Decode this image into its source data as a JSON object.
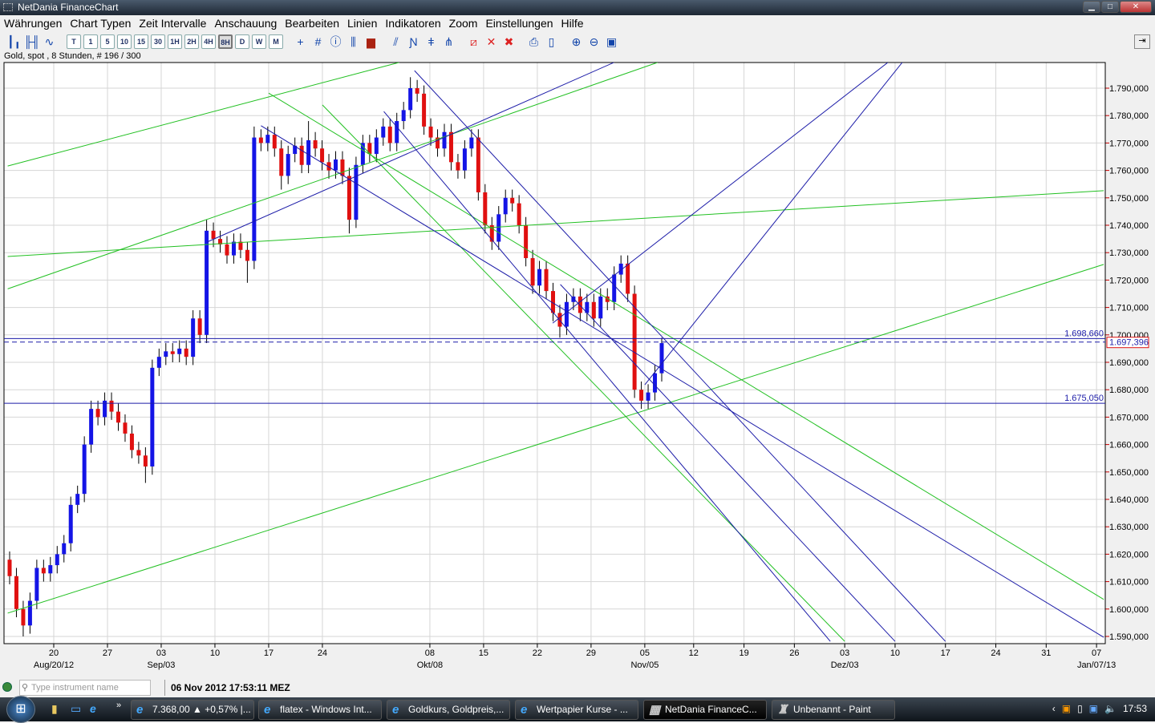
{
  "window": {
    "title": "NetDania FinanceChart",
    "buttons": [
      "minimize",
      "maximize",
      "close"
    ]
  },
  "menu": [
    "Währungen",
    "Chart Typen",
    "Zeit Intervalle",
    "Anschauung",
    "Bearbeiten",
    "Linien",
    "Indikatoren",
    "Zoom",
    "Einstellungen",
    "Hilfe"
  ],
  "toolbar": {
    "chart_type_icons": [
      "candlestick-icon",
      "bar-chart-icon",
      "line-chart-icon"
    ],
    "intervals": [
      "T",
      "1",
      "5",
      "10",
      "15",
      "30",
      "1H",
      "2H",
      "4H",
      "8H",
      "D",
      "W",
      "M"
    ],
    "selected_interval": "8H",
    "tool_icons": [
      "crosshair-icon",
      "grid-icon",
      "info-icon",
      "volume-icon",
      "histogram-icon",
      "trendline-icon",
      "channel-icon",
      "fibonacci-icon",
      "fan-icon",
      "delete-line-icon",
      "delete-icon",
      "delete-all-icon",
      "print-icon",
      "print-preview-icon",
      "zoom-in-icon",
      "zoom-out-icon",
      "zoom-reset-icon"
    ],
    "right_icon": "panel-toggle-icon"
  },
  "info_line": "Gold, spot , 8 Stunden, # 196 / 300",
  "colors": {
    "up": "#1414e6",
    "down": "#e01010",
    "grid": "#d6d6d6",
    "green_line": "#22c022",
    "blue_line": "#1c1ca8",
    "label_blue": "#1c1ca8",
    "last_price_border": "#e01010"
  },
  "chart_data": {
    "type": "candlestick",
    "instrument": "Gold, spot",
    "interval": "8 Stunden",
    "ylim": [
      1587,
      1799
    ],
    "yticks": [
      1590,
      1600,
      1610,
      1620,
      1630,
      1640,
      1650,
      1660,
      1670,
      1680,
      1690,
      1700,
      1710,
      1720,
      1730,
      1740,
      1750,
      1760,
      1770,
      1780,
      1790
    ],
    "ytick_labels": [
      "1.590,000",
      "1.600,000",
      "1.610,000",
      "1.620,000",
      "1.630,000",
      "1.640,000",
      "1.650,000",
      "1.660,000",
      "1.670,000",
      "1.680,000",
      "1.690,000",
      "1.700,000",
      "1.710,000",
      "1.720,000",
      "1.730,000",
      "1.740,000",
      "1.750,000",
      "1.760,000",
      "1.770,000",
      "1.780,000",
      "1.790,000"
    ],
    "xticks": [
      {
        "date": "2012-08-20",
        "label": "20",
        "sub": "Aug/20/12"
      },
      {
        "date": "2012-08-27",
        "label": "27"
      },
      {
        "date": "2012-09-03",
        "label": "03",
        "sub": "Sep/03"
      },
      {
        "date": "2012-09-10",
        "label": "10"
      },
      {
        "date": "2012-09-17",
        "label": "17"
      },
      {
        "date": "2012-09-24",
        "label": "24"
      },
      {
        "date": "2012-10-08",
        "label": "08",
        "sub": "Okt/08"
      },
      {
        "date": "2012-10-15",
        "label": "15"
      },
      {
        "date": "2012-10-22",
        "label": "22"
      },
      {
        "date": "2012-10-29",
        "label": "29"
      },
      {
        "date": "2012-11-05",
        "label": "05",
        "sub": "Nov/05"
      },
      {
        "date": "2012-11-12",
        "label": "12"
      },
      {
        "date": "2012-11-19",
        "label": "19"
      },
      {
        "date": "2012-11-26",
        "label": "26"
      },
      {
        "date": "2012-12-03",
        "label": "03",
        "sub": "Dez/03"
      },
      {
        "date": "2012-12-10",
        "label": "10"
      },
      {
        "date": "2012-12-17",
        "label": "17"
      },
      {
        "date": "2012-12-24",
        "label": "24"
      },
      {
        "date": "2012-12-31",
        "label": "31"
      },
      {
        "date": "2013-01-07",
        "label": "07",
        "sub": "Jan/07/13"
      }
    ],
    "candles_ohlc": [
      [
        1618,
        1621,
        1609,
        1612
      ],
      [
        1612,
        1615,
        1597,
        1600
      ],
      [
        1600,
        1603,
        1590,
        1594
      ],
      [
        1594,
        1606,
        1591,
        1603
      ],
      [
        1603,
        1618,
        1600,
        1615
      ],
      [
        1615,
        1618,
        1610,
        1613
      ],
      [
        1613,
        1619,
        1610,
        1616
      ],
      [
        1616,
        1623,
        1613,
        1620
      ],
      [
        1620,
        1627,
        1617,
        1624
      ],
      [
        1624,
        1641,
        1621,
        1638
      ],
      [
        1638,
        1645,
        1635,
        1642
      ],
      [
        1642,
        1663,
        1639,
        1660
      ],
      [
        1660,
        1676,
        1657,
        1673
      ],
      [
        1673,
        1676,
        1667,
        1670
      ],
      [
        1670,
        1679,
        1667,
        1676
      ],
      [
        1676,
        1679,
        1669,
        1672
      ],
      [
        1672,
        1675,
        1665,
        1668
      ],
      [
        1668,
        1671,
        1661,
        1664
      ],
      [
        1664,
        1667,
        1655,
        1658
      ],
      [
        1658,
        1661,
        1653,
        1656
      ],
      [
        1656,
        1659,
        1646,
        1652
      ],
      [
        1652,
        1691,
        1649,
        1688
      ],
      [
        1688,
        1695,
        1685,
        1692
      ],
      [
        1692,
        1697,
        1689,
        1694
      ],
      [
        1694,
        1697,
        1690,
        1693
      ],
      [
        1693,
        1698,
        1690,
        1695
      ],
      [
        1695,
        1698,
        1689,
        1692
      ],
      [
        1692,
        1709,
        1689,
        1706
      ],
      [
        1706,
        1709,
        1697,
        1700
      ],
      [
        1700,
        1742,
        1697,
        1738
      ],
      [
        1738,
        1741,
        1732,
        1735
      ],
      [
        1735,
        1738,
        1730,
        1733
      ],
      [
        1733,
        1736,
        1726,
        1729
      ],
      [
        1729,
        1737,
        1726,
        1734
      ],
      [
        1734,
        1737,
        1728,
        1731
      ],
      [
        1731,
        1734,
        1719,
        1727
      ],
      [
        1727,
        1776,
        1724,
        1772
      ],
      [
        1772,
        1775,
        1767,
        1770
      ],
      [
        1770,
        1776,
        1767,
        1773
      ],
      [
        1773,
        1776,
        1765,
        1768
      ],
      [
        1768,
        1771,
        1753,
        1758
      ],
      [
        1758,
        1769,
        1755,
        1766
      ],
      [
        1766,
        1772,
        1763,
        1769
      ],
      [
        1769,
        1772,
        1759,
        1762
      ],
      [
        1762,
        1778,
        1759,
        1771
      ],
      [
        1771,
        1774,
        1765,
        1768
      ],
      [
        1768,
        1771,
        1760,
        1763
      ],
      [
        1763,
        1766,
        1757,
        1760
      ],
      [
        1760,
        1767,
        1757,
        1764
      ],
      [
        1764,
        1767,
        1755,
        1758
      ],
      [
        1758,
        1761,
        1737,
        1742
      ],
      [
        1742,
        1765,
        1739,
        1762
      ],
      [
        1762,
        1773,
        1759,
        1770
      ],
      [
        1770,
        1773,
        1763,
        1766
      ],
      [
        1766,
        1775,
        1763,
        1772
      ],
      [
        1772,
        1779,
        1769,
        1776
      ],
      [
        1776,
        1779,
        1767,
        1770
      ],
      [
        1770,
        1781,
        1767,
        1778
      ],
      [
        1778,
        1785,
        1775,
        1782
      ],
      [
        1782,
        1794,
        1779,
        1790
      ],
      [
        1790,
        1793,
        1785,
        1788
      ],
      [
        1788,
        1791,
        1773,
        1776
      ],
      [
        1776,
        1779,
        1769,
        1772
      ],
      [
        1772,
        1775,
        1765,
        1768
      ],
      [
        1768,
        1777,
        1765,
        1774
      ],
      [
        1774,
        1777,
        1760,
        1763
      ],
      [
        1763,
        1766,
        1757,
        1760
      ],
      [
        1760,
        1771,
        1757,
        1768
      ],
      [
        1768,
        1775,
        1765,
        1772
      ],
      [
        1772,
        1775,
        1749,
        1752
      ],
      [
        1752,
        1755,
        1737,
        1740
      ],
      [
        1740,
        1743,
        1731,
        1734
      ],
      [
        1734,
        1747,
        1731,
        1744
      ],
      [
        1744,
        1753,
        1741,
        1750
      ],
      [
        1750,
        1753,
        1745,
        1748
      ],
      [
        1748,
        1751,
        1737,
        1740
      ],
      [
        1740,
        1743,
        1725,
        1728
      ],
      [
        1728,
        1731,
        1715,
        1718
      ],
      [
        1718,
        1727,
        1715,
        1724
      ],
      [
        1724,
        1727,
        1713,
        1716
      ],
      [
        1716,
        1719,
        1705,
        1708
      ],
      [
        1708,
        1711,
        1699,
        1703
      ],
      [
        1703,
        1715,
        1700,
        1712
      ],
      [
        1712,
        1717,
        1709,
        1714
      ],
      [
        1714,
        1717,
        1705,
        1708
      ],
      [
        1708,
        1715,
        1705,
        1712
      ],
      [
        1712,
        1715,
        1703,
        1706
      ],
      [
        1706,
        1717,
        1703,
        1714
      ],
      [
        1714,
        1717,
        1709,
        1712
      ],
      [
        1712,
        1725,
        1709,
        1722
      ],
      [
        1722,
        1729,
        1719,
        1726
      ],
      [
        1726,
        1729,
        1712,
        1715
      ],
      [
        1715,
        1718,
        1677,
        1680
      ],
      [
        1680,
        1683,
        1673,
        1676
      ],
      [
        1676,
        1682,
        1673,
        1679
      ],
      [
        1679,
        1689,
        1676,
        1686
      ],
      [
        1686,
        1699,
        1683,
        1697
      ]
    ],
    "horizontal_lines": [
      {
        "price": 1698.66,
        "label": "1.698,660",
        "style": "solid"
      },
      {
        "price": 1697.396,
        "label": "1.697,396",
        "style": "dashed",
        "last_price": true
      },
      {
        "price": 1675.05,
        "label": "1.675,050",
        "style": "solid"
      }
    ],
    "trendlines": [
      {
        "color": "green",
        "from": [
          "2012-08-14",
          1761.6
        ],
        "to": [
          "2012-10-04",
          1799.4
        ]
      },
      {
        "color": "green",
        "from": [
          "2012-08-14",
          1716.8
        ],
        "to": [
          "2012-11-07",
          1799.4
        ]
      },
      {
        "color": "green",
        "from": [
          "2012-08-14",
          1728.6
        ],
        "to": [
          "2013-01-08",
          1752.6
        ]
      },
      {
        "color": "green",
        "from": [
          "2012-08-14",
          1598.5
        ],
        "to": [
          "2013-01-08",
          1725.7
        ]
      },
      {
        "color": "green",
        "from": [
          "2012-09-17",
          1788.2
        ],
        "to": [
          "2013-01-08",
          1603.5
        ]
      },
      {
        "color": "green",
        "from": [
          "2012-09-24",
          1783.9
        ],
        "to": [
          "2012-12-03",
          1588.2
        ]
      },
      {
        "color": "blue",
        "from": [
          "2012-09-09",
          1733.9
        ],
        "to": [
          "2012-11-01",
          1799.4
        ]
      },
      {
        "color": "blue",
        "from": [
          "2012-09-16",
          1776.3
        ],
        "to": [
          "2013-01-08",
          1589.7
        ]
      },
      {
        "color": "blue",
        "from": [
          "2012-10-02",
          1781.5
        ],
        "to": [
          "2012-12-01",
          1588.2
        ]
      },
      {
        "color": "blue",
        "from": [
          "2012-10-06",
          1796.4
        ],
        "to": [
          "2012-12-17",
          1588.2
        ]
      },
      {
        "color": "blue",
        "from": [
          "2012-10-24",
          1704.3
        ],
        "to": [
          "2012-12-09",
          1799.4
        ]
      },
      {
        "color": "blue",
        "from": [
          "2012-11-05",
          1681.8
        ],
        "to": [
          "2012-12-11",
          1799.4
        ]
      },
      {
        "color": "blue",
        "from": [
          "2012-10-25",
          1718.4
        ],
        "to": [
          "2012-12-10",
          1588.2
        ]
      }
    ]
  },
  "statusbar": {
    "search_placeholder": "Type instrument name",
    "datetime": "06 Nov 2012 17:53:11 MEZ"
  },
  "taskbar": {
    "tasks": [
      {
        "label": "7.368,00 ▲ +0,57% |...",
        "icon": "ie-icon"
      },
      {
        "label": "flatex - Windows Int...",
        "icon": "ie-icon"
      },
      {
        "label": "Goldkurs, Goldpreis,...",
        "icon": "ie-icon"
      },
      {
        "label": "Wertpapier Kurse - ...",
        "icon": "ie-icon"
      },
      {
        "label": "NetDania FinanceC...",
        "icon": "netdania-icon",
        "active": true
      },
      {
        "label": "Unbenannt - Paint",
        "icon": "paint-icon"
      }
    ],
    "clock": "17:53"
  }
}
